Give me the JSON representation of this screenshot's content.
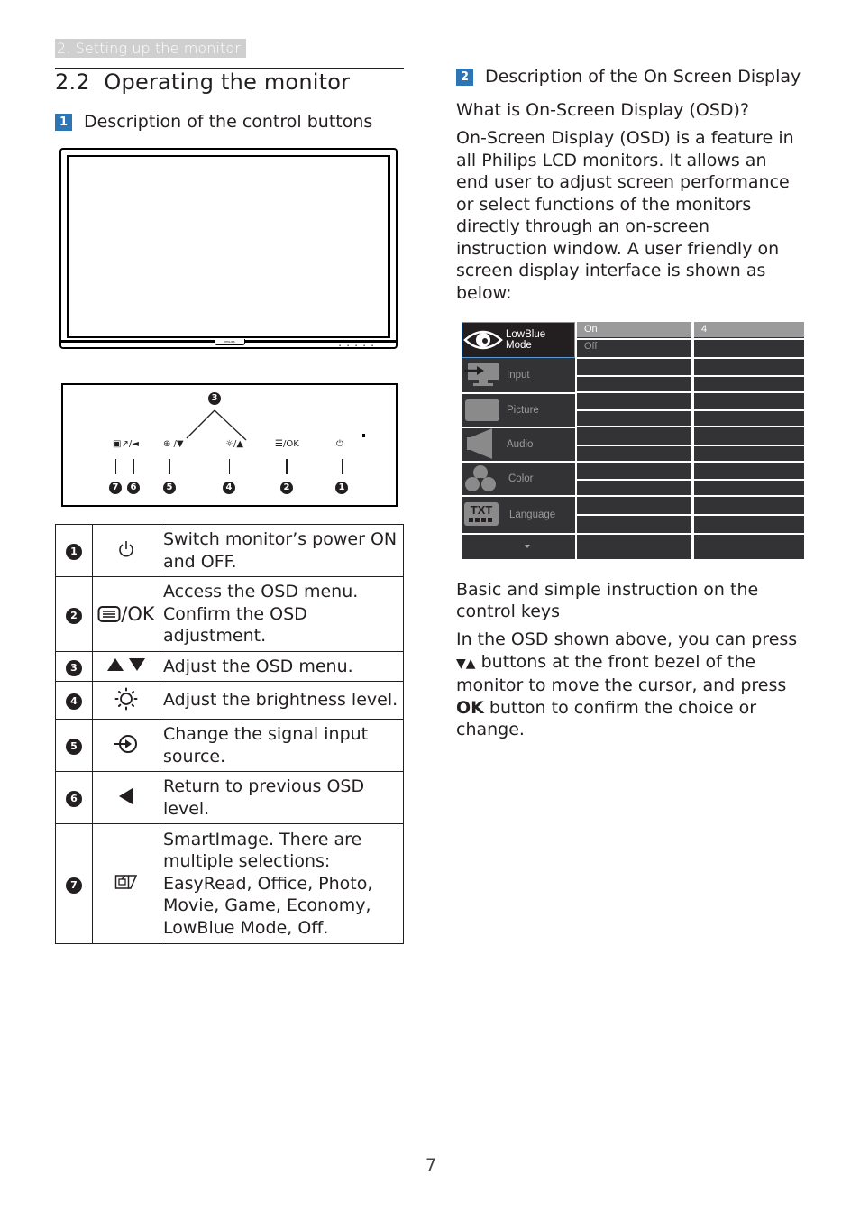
{
  "running_head": "2. Setting up the monitor",
  "section": {
    "number": "2.2",
    "title": "2.2  Operating the monitor"
  },
  "left": {
    "subsection_1": {
      "badge": "1",
      "title": "Description of the control buttons"
    },
    "monitor_illustration": {
      "brand": "PHILIPS"
    },
    "panel": {
      "labels": [
        "▣↗/◄",
        "⊕ /▼",
        "☼/▲",
        "☰/OK",
        "⏻"
      ],
      "callouts": [
        "7",
        "6",
        "5",
        "4",
        "2",
        "1",
        "3"
      ]
    },
    "table": {
      "rows": [
        {
          "num": "1",
          "icon": "power-icon",
          "desc": "Switch monitor’s power ON and OFF."
        },
        {
          "num": "2",
          "icon": "menu-ok-icon",
          "icon_text": "/OK",
          "desc": "Access the OSD menu. Confirm the OSD adjustment."
        },
        {
          "num": "3",
          "icon": "up-down-arrows-icon",
          "desc": "Adjust the OSD menu."
        },
        {
          "num": "4",
          "icon": "brightness-icon",
          "desc": "Adjust the brightness level."
        },
        {
          "num": "5",
          "icon": "input-source-icon",
          "desc": "Change the signal input source."
        },
        {
          "num": "6",
          "icon": "back-arrow-icon",
          "desc": "Return to previous OSD level."
        },
        {
          "num": "7",
          "icon": "smartimage-icon",
          "desc": "SmartImage. There are multiple selections: EasyRead, Office, Photo, Movie, Game, Economy, LowBlue Mode, Off."
        }
      ]
    }
  },
  "right": {
    "subsection_2": {
      "badge": "2",
      "title": "Description of the On Screen Display"
    },
    "what_is_heading": "What is On-Screen Display (OSD)?",
    "what_is_body": "On-Screen Display (OSD) is a feature in all Philips LCD monitors. It allows an end user to adjust screen performance or select functions of the monitors directly through an on-screen instruction window. A user friendly on screen display interface is shown as below:",
    "osd": {
      "menu": [
        {
          "label": "LowBlue Mode",
          "icon": "eye-icon",
          "active": true
        },
        {
          "label": "Input",
          "icon": "input-icon",
          "active": false
        },
        {
          "label": "Picture",
          "icon": "picture-icon",
          "active": false
        },
        {
          "label": "Audio",
          "icon": "audio-icon",
          "active": false
        },
        {
          "label": "Color",
          "icon": "color-icon",
          "active": false
        },
        {
          "label": "Language",
          "icon": "language-icon",
          "active": false
        }
      ],
      "options": {
        "selected": "On",
        "other": "Off"
      },
      "value": "4",
      "colors": {
        "panel": "#333336",
        "highlight": "#9a9a9a",
        "active_border": "#5a9bd5"
      }
    },
    "basic_heading": "Basic and simple instruction on the control keys",
    "basic_body_prefix": "In the OSD shown above, you can press ",
    "basic_body_arrows": "▼▲",
    "basic_body_mid": " buttons at the front bezel of the monitor to move the cursor, and press ",
    "basic_body_ok": "OK",
    "basic_body_suffix": " button to confirm the choice or change."
  },
  "page_number": "7"
}
